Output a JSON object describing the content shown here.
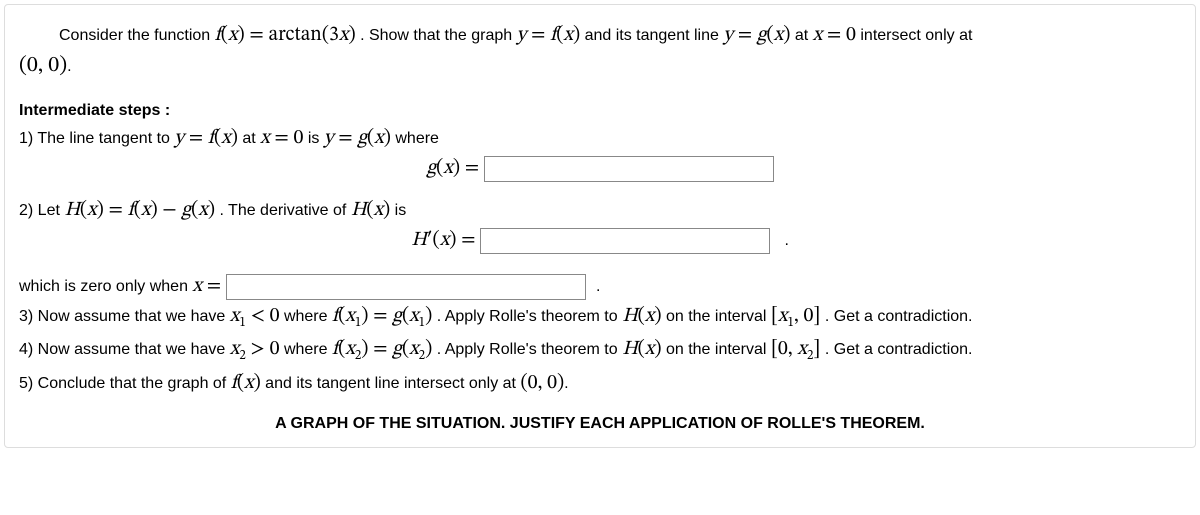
{
  "intro": {
    "lead": "Consider the function ",
    "fdef": "f(x) = arctan(3x)",
    "mid1": ". Show that the graph ",
    "yfx": "y = f(x)",
    "mid2": " and its tangent line ",
    "ygx": "y = g(x)",
    "mid3": " at ",
    "x0": "x = 0",
    "mid4": " intersect only at",
    "origin": "(0, 0)",
    "period": "."
  },
  "steps_header": "Intermediate steps :",
  "step1": {
    "lead": "1) The line tangent to ",
    "yfx": "y = f(x)",
    "mid1": " at ",
    "x0": "x = 0",
    "mid2": " is ",
    "ygx": "y = g(x)",
    "mid3": " where",
    "gx_eq": "g(x) ="
  },
  "step2": {
    "lead": "2) Let ",
    "Hdef": "H(x) = f(x) − g(x)",
    "mid1": ". The derivative of ",
    "Hx": "H(x)",
    "mid2": " is",
    "Hprime_eq": "H′(x) =",
    "period": "."
  },
  "which": {
    "lead": "which is zero only when ",
    "xeq": "x =",
    "period": "."
  },
  "step3": {
    "lead": "3) Now assume that we have ",
    "x1lt0": "x",
    "sub1": "1",
    "lt0": " < 0",
    "mid1": " where ",
    "fx1": "f(x",
    "fx1b": ") = g(x",
    "fx1c": ")",
    "mid2": ". Apply Rolle's theorem to ",
    "Hx": "H(x)",
    "mid3": " on the interval ",
    "int1": "[x",
    "int1b": ", 0]",
    "tail": ". Get a contradiction."
  },
  "step4": {
    "lead": "4) Now assume that we have ",
    "x2gt0": "x",
    "sub2": "2",
    "gt0": " > 0",
    "mid1": " where ",
    "fx2": "f(x",
    "fx2b": ") = g(x",
    "fx2c": ")",
    "mid2": ". Apply Rolle's theorem to ",
    "Hx": "H(x)",
    "mid3": " on the interval ",
    "int2": "[0, x",
    "int2b": "]",
    "tail": ". Get a contradiction."
  },
  "step5": {
    "lead": "5) Conclude that the graph of ",
    "fx": "f(x)",
    "mid1": " and its tangent line intersect only at ",
    "origin": "(0, 0)",
    "period": "."
  },
  "footer": "A GRAPH OF THE SITUATION. JUSTIFY EACH APPLICATION OF ROLLE'S THEOREM."
}
